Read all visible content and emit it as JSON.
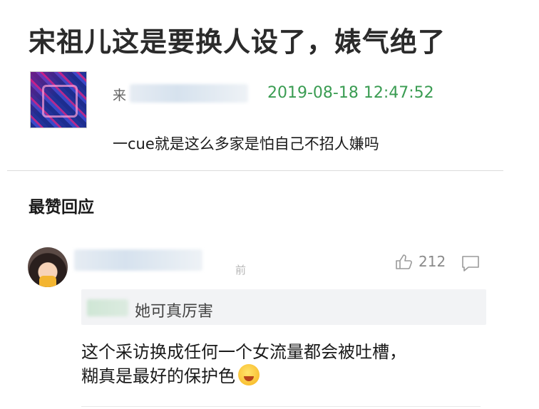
{
  "post": {
    "title": "宋祖儿这是要换人设了，婊气绝了",
    "author_prefix": "来",
    "timestamp": "2019-08-18 12:47:52",
    "text": "一cue就是这么多家是怕自己不招人嫌吗"
  },
  "top_replies": {
    "heading": "最赞回应",
    "reply": {
      "time_fragment": "前",
      "like_count": "212",
      "quoted_text": "她可真厉害",
      "text_line1": "这个采访换成任何一个女流量都会被吐槽，",
      "text_line2": "糊真是最好的保护色"
    }
  },
  "colors": {
    "timestamp_green": "#3a9c52",
    "quote_bg": "#f2f3f5"
  },
  "icons": [
    "thumbs-up-icon",
    "comment-icon",
    "angry-face-emoji"
  ]
}
